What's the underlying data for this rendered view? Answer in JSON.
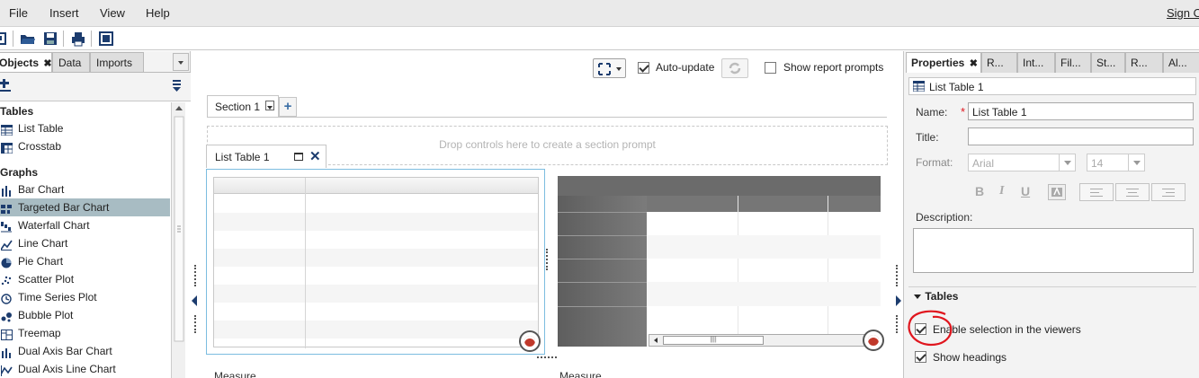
{
  "menu": {
    "items": [
      "File",
      "Insert",
      "View",
      "Help"
    ],
    "signout": "Sign O"
  },
  "toolbar": {
    "icons": [
      "new-report-icon",
      "open-folder-icon",
      "save-icon",
      "print-icon",
      "screen-mode-icon"
    ]
  },
  "left_panel": {
    "tabs": [
      "Objects",
      "Data",
      "Imports"
    ],
    "active_tab": "Objects",
    "groups": [
      {
        "label": "Tables",
        "items": [
          {
            "label": "List Table",
            "icon": "list-table-icon"
          },
          {
            "label": "Crosstab",
            "icon": "crosstab-icon"
          }
        ]
      },
      {
        "label": "Graphs",
        "items": [
          {
            "label": "Bar Chart",
            "icon": "bar-chart-icon"
          },
          {
            "label": "Targeted Bar Chart",
            "icon": "targeted-bar-chart-icon",
            "selected": true
          },
          {
            "label": "Waterfall Chart",
            "icon": "waterfall-chart-icon"
          },
          {
            "label": "Line Chart",
            "icon": "line-chart-icon"
          },
          {
            "label": "Pie Chart",
            "icon": "pie-chart-icon"
          },
          {
            "label": "Scatter Plot",
            "icon": "scatter-plot-icon"
          },
          {
            "label": "Time Series Plot",
            "icon": "time-series-plot-icon"
          },
          {
            "label": "Bubble Plot",
            "icon": "bubble-plot-icon"
          },
          {
            "label": "Treemap",
            "icon": "treemap-icon"
          },
          {
            "label": "Dual Axis Bar Chart",
            "icon": "dual-axis-bar-chart-icon"
          },
          {
            "label": "Dual Axis Line Chart",
            "icon": "dual-axis-line-chart-icon"
          }
        ]
      }
    ]
  },
  "canvas": {
    "auto_update_label": "Auto-update",
    "auto_update_checked": true,
    "show_prompts_label": "Show report prompts",
    "show_prompts_checked": false,
    "section_tab": "Section 1",
    "drop_prompt": "Drop controls here to create a section prompt",
    "list_table_tab": "List Table 1",
    "measure_label_left": "Measure",
    "measure_label_right": "Measure"
  },
  "right_panel": {
    "tabs": [
      "Properties",
      "R...",
      "Int...",
      "Fil...",
      "St...",
      "R...",
      "Al..."
    ],
    "active_tab": "Properties",
    "selected_object": "List Table 1",
    "name_label": "Name:",
    "name_value": "List Table 1",
    "title_label": "Title:",
    "title_value": "",
    "format_label": "Format:",
    "font_value": "Arial",
    "size_value": "14",
    "description_label": "Description:",
    "description_value": "",
    "tables_section": "Tables",
    "enable_selection_label": "Enable selection in the viewers",
    "enable_selection_checked": true,
    "show_headings_label": "Show headings",
    "show_headings_checked": true,
    "annotation_color": "#e0161e"
  },
  "colors": {
    "selection_highlight": "#a8bcc3",
    "frame_border": "#7cbde0",
    "accent_blue": "#3a6ea5"
  }
}
